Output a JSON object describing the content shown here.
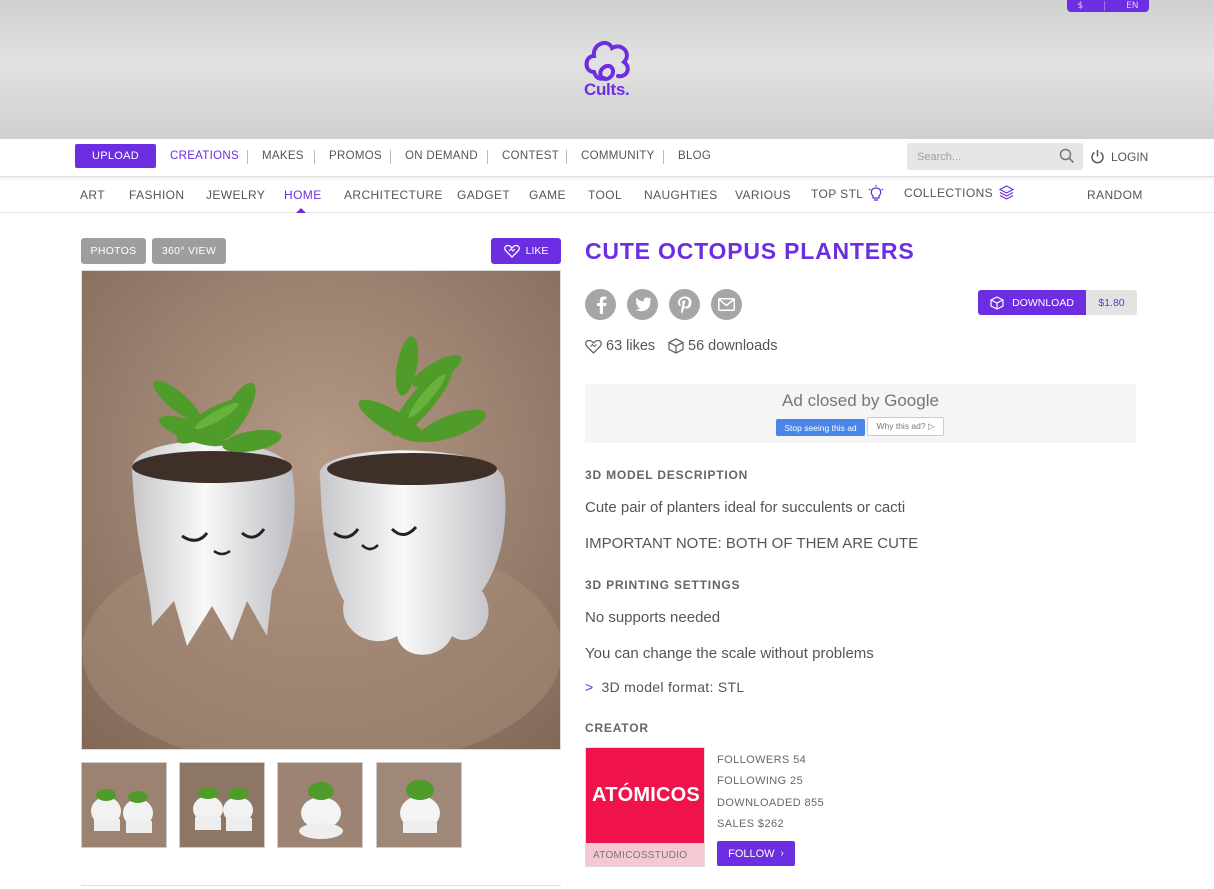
{
  "header": {
    "currency": "$",
    "language": "EN",
    "logo_text": "Cults."
  },
  "nav_primary": {
    "upload_label": "UPLOAD",
    "items": [
      "CREATIONS",
      "MAKES",
      "PROMOS",
      "ON DEMAND",
      "CONTEST",
      "COMMUNITY",
      "BLOG"
    ],
    "active": "CREATIONS",
    "search_placeholder": "Search...",
    "login_label": "LOGIN"
  },
  "nav_categories": {
    "items": [
      "ART",
      "FASHION",
      "JEWELRY",
      "HOME",
      "ARCHITECTURE",
      "GADGET",
      "GAME",
      "TOOL",
      "NAUGHTIES",
      "VARIOUS",
      "TOP STL",
      "COLLECTIONS"
    ],
    "active": "HOME",
    "random_label": "RANDOM"
  },
  "gallery": {
    "photos_label": "PHOTOS",
    "view360_label": "360° VIEW",
    "like_label": "LIKE",
    "thumbnail_count": 4
  },
  "product": {
    "title": "CUTE OCTOPUS PLANTERS",
    "download_label": "DOWNLOAD",
    "price": "$1.80",
    "likes": "63 likes",
    "downloads": "56 downloads"
  },
  "ad": {
    "title_prefix": "Ad closed by ",
    "title_brand": "Google",
    "stop_label": "Stop seeing this ad",
    "why_label": "Why this ad? ▷"
  },
  "description": {
    "heading": "3D MODEL DESCRIPTION",
    "lines": [
      "Cute pair of planters ideal for succulents or cacti",
      "IMPORTANT NOTE: BOTH OF THEM ARE CUTE"
    ]
  },
  "printing": {
    "heading": "3D PRINTING SETTINGS",
    "lines": [
      "No supports needed",
      "You can change the scale without problems"
    ],
    "format": "3D model format: STL"
  },
  "creator": {
    "heading": "CREATOR",
    "logo_text": "ATÓMICOS",
    "name": "ATOMICOSSTUDIO",
    "followers": "FOLLOWERS 54",
    "following": "FOLLOWING 25",
    "downloaded": "DOWNLOADED 855",
    "sales": "SALES $262",
    "follow_label": "FOLLOW"
  },
  "colors": {
    "accent": "#6c2ee0",
    "creator_brand": "#f0124a"
  }
}
